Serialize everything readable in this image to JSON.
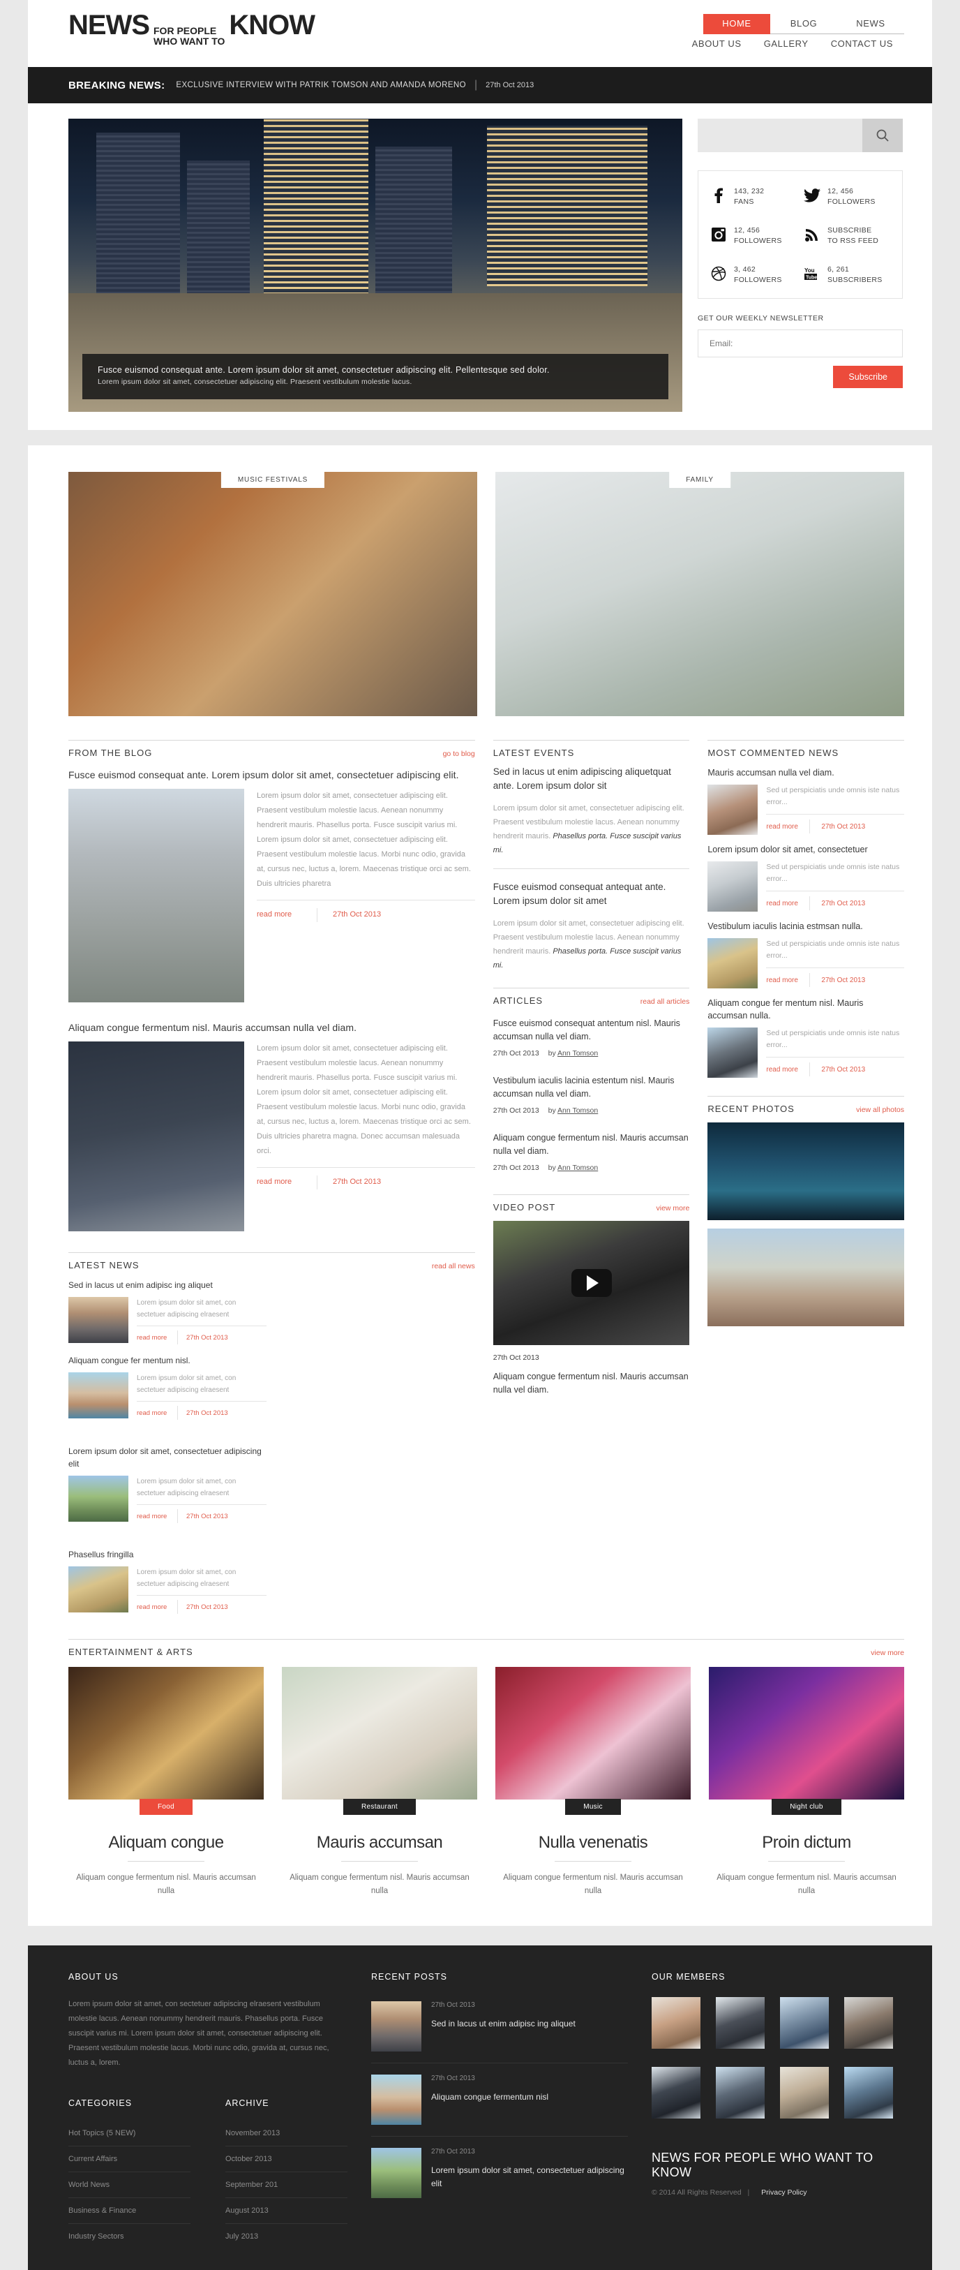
{
  "site": {
    "logo_news": "NEWS",
    "logo_line1": "FOR PEOPLE",
    "logo_line2": "WHO WANT TO",
    "logo_know": "KNOW",
    "accent": "#ec4b3b",
    "dark": "#232323"
  },
  "nav": {
    "row1": [
      {
        "label": "HOME",
        "active": true
      },
      {
        "label": "BLOG",
        "active": false
      },
      {
        "label": "NEWS",
        "active": false
      }
    ],
    "row2": [
      {
        "label": "ABOUT US"
      },
      {
        "label": "GALLERY"
      },
      {
        "label": "CONTACT US"
      }
    ]
  },
  "breaking": {
    "label": "BREAKING NEWS:",
    "text": "EXCLUSIVE INTERVIEW WITH PATRIK TOMSON AND AMANDA MORENO",
    "separator": "|",
    "date": "27th Oct 2013"
  },
  "hero": {
    "caption_line1": "Fusce euismod consequat ante. Lorem ipsum dolor sit amet, consectetuer adipiscing elit. Pellentesque sed dolor.",
    "caption_line2": "Lorem ipsum dolor sit amet, consectetuer adipiscing elit. Praesent vestibulum molestie lacus."
  },
  "search": {
    "value": "",
    "placeholder": "",
    "icon": "search-icon"
  },
  "social": [
    {
      "icon": "facebook-icon",
      "count": "143, 232",
      "label": "FANS"
    },
    {
      "icon": "twitter-icon",
      "count": "12, 456",
      "label": "FOLLOWERS"
    },
    {
      "icon": "instagram-icon",
      "count": "12, 456",
      "label": "FOLLOWERS"
    },
    {
      "icon": "rss-icon",
      "count": "SUBSCRIBE",
      "label": "TO RSS FEED"
    },
    {
      "icon": "dribbble-icon",
      "count": "3, 462",
      "label": "FOLLOWERS"
    },
    {
      "icon": "youtube-icon",
      "count": "6, 261",
      "label": "SUBSCRIBERS"
    }
  ],
  "newsletter": {
    "title": "GET OUR WEEKLY NEWSLETTER",
    "placeholder": "Email:",
    "value": "",
    "button": "Subscribe"
  },
  "features": [
    {
      "badge": "MUSIC FESTIVALS"
    },
    {
      "badge": "FAMILY"
    }
  ],
  "blog": {
    "title": "FROM THE BLOG",
    "link": "go to blog",
    "posts": [
      {
        "title": "Fusce euismod consequat ante. Lorem ipsum dolor sit amet, consectetuer adipiscing elit.",
        "text": "Lorem ipsum dolor sit amet, consectetuer adipiscing elit. Praesent vestibulum molestie lacus. Aenean nonummy hendrerit mauris. Phasellus porta. Fusce suscipit varius mi. Lorem ipsum dolor sit amet, consectetuer adipiscing elit. Praesent vestibulum molestie lacus. Morbi nunc odio, gravida at, cursus nec, luctus a, lorem. Maecenas tristique orci ac sem. Duis ultricies pharetra",
        "read_more": "read more",
        "date": "27th Oct 2013"
      },
      {
        "title": "Aliquam congue fermentum nisl. Mauris accumsan nulla vel diam.",
        "text": "Lorem ipsum dolor sit amet, consectetuer adipiscing elit. Praesent vestibulum molestie lacus. Aenean nonummy hendrerit mauris. Phasellus porta. Fusce suscipit varius mi. Lorem ipsum dolor sit amet, consectetuer adipiscing elit. Praesent vestibulum molestie lacus. Morbi nunc odio, gravida at, cursus nec, luctus a, lorem. Maecenas tristique orci ac sem. Duis ultricies pharetra magna. Donec accumsan malesuada orci.",
        "read_more": "read more",
        "date": "27th Oct 2013"
      }
    ]
  },
  "events": {
    "title": "LATEST EVENTS",
    "items": [
      {
        "title": "Sed in lacus ut enim adipiscing aliquetquat ante. Lorem ipsum dolor sit",
        "text": "Lorem ipsum dolor sit amet, consectetuer adipiscing elit. Praesent vestibulum molestie lacus. Aenean nonummy hendrerit mauris. ",
        "emph": "Phasellus porta. Fusce suscipit varius mi."
      },
      {
        "title": "Fusce euismod consequat antequat ante. Lorem ipsum dolor sit amet",
        "text": "Lorem ipsum dolor sit amet, consectetuer adipiscing elit. Praesent vestibulum molestie lacus. Aenean nonummy hendrerit mauris. ",
        "emph": "Phasellus porta. Fusce suscipit varius mi."
      }
    ]
  },
  "articles": {
    "title": "ARTICLES",
    "link": "read all articles",
    "items": [
      {
        "title": "Fusce euismod consequat antentum nisl. Mauris accumsan nulla vel diam.",
        "date": "27th Oct 2013",
        "by_prefix": "by",
        "author": "Ann Tomson"
      },
      {
        "title": "Vestibulum iaculis lacinia estentum nisl. Mauris accumsan nulla vel diam.",
        "date": "27th Oct 2013",
        "by_prefix": "by",
        "author": "Ann Tomson"
      },
      {
        "title": "Aliquam congue fermentum nisl. Mauris accumsan nulla vel diam.",
        "date": "27th Oct 2013",
        "by_prefix": "by",
        "author": "Ann Tomson"
      }
    ]
  },
  "most_commented": {
    "title": "MOST COMMENTED NEWS",
    "items": [
      {
        "title": "Mauris accumsan nulla vel diam.",
        "text": "Sed ut perspiciatis unde omnis iste natus error...",
        "read_more": "read more",
        "date": "27th Oct 2013"
      },
      {
        "title": "Lorem ipsum dolor sit amet, consectetuer",
        "text": "Sed ut perspiciatis unde omnis iste natus error...",
        "read_more": "read more",
        "date": "27th Oct 2013"
      },
      {
        "title": "Vestibulum iaculis lacinia estmsan nulla.",
        "text": "Sed ut perspiciatis unde omnis iste natus error...",
        "read_more": "read more",
        "date": "27th Oct 2013"
      },
      {
        "title": "Aliquam congue fer mentum nisl. Mauris accumsan nulla.",
        "text": "Sed ut perspiciatis unde omnis iste natus error...",
        "read_more": "read more",
        "date": "27th Oct 2013"
      }
    ]
  },
  "latest_news": {
    "title": "LATEST NEWS",
    "link": "read all news",
    "items": [
      {
        "title": "Sed in lacus ut enim adipisc ing aliquet",
        "text": "Lorem ipsum dolor sit amet, con sectetuer adipiscing elraesent",
        "read_more": "read more",
        "date": "27th Oct 2013"
      },
      {
        "title": "Aliquam congue fer mentum nisl.",
        "text": "Lorem ipsum dolor sit amet, con sectetuer adipiscing elraesent",
        "read_more": "read more",
        "date": "27th Oct 2013"
      },
      {
        "title": "Lorem ipsum dolor sit amet, consectetuer adipiscing elit",
        "text": "Lorem ipsum dolor sit amet, con sectetuer adipiscing elraesent",
        "read_more": "read more",
        "date": "27th Oct 2013"
      },
      {
        "title": "Phasellus fringilla",
        "text": "Lorem ipsum dolor sit amet, con sectetuer adipiscing elraesent",
        "read_more": "read more",
        "date": "27th Oct 2013"
      }
    ]
  },
  "video": {
    "title": "VIDEO POST",
    "link": "view more",
    "date": "27th Oct 2013",
    "caption": "Aliquam congue fermentum nisl. Mauris accumsan nulla vel diam.",
    "play_icon": "play-icon"
  },
  "recent_photos": {
    "title": "RECENT PHOTOS",
    "link": "view all photos"
  },
  "entertainment": {
    "title": "ENTERTAINMENT & ARTS",
    "link": "view more",
    "cards": [
      {
        "tag": "Food",
        "tag_accent": true,
        "name": "Aliquam congue",
        "desc": "Aliquam congue fermentum nisl. Mauris accumsan nulla"
      },
      {
        "tag": "Restaurant",
        "tag_accent": false,
        "name": "Mauris accumsan",
        "desc": "Aliquam congue fermentum nisl. Mauris accumsan nulla"
      },
      {
        "tag": "Music",
        "tag_accent": false,
        "name": "Nulla venenatis",
        "desc": "Aliquam congue fermentum nisl. Mauris accumsan nulla"
      },
      {
        "tag": "Night club",
        "tag_accent": false,
        "name": "Proin dictum",
        "desc": "Aliquam congue fermentum nisl. Mauris accumsan nulla"
      }
    ]
  },
  "footer": {
    "about": {
      "title": "ABOUT US",
      "text": "Lorem ipsum dolor sit amet, con sectetuer adipiscing elraesent vestibulum molestie lacus. Aenean nonummy hendrerit mauris. Phasellus porta. Fusce suscipit varius mi. Lorem ipsum dolor sit amet, consectetuer adipiscing elit. Praesent vestibulum molestie lacus. Morbi nunc odio, gravida at, cursus nec, luctus a, lorem."
    },
    "categories": {
      "title": "CATEGORIES",
      "items": [
        "Hot Topics (5 NEW)",
        "Current Affairs",
        "World News",
        "Business & Finance",
        "Industry Sectors"
      ]
    },
    "archive": {
      "title": "ARCHIVE",
      "items": [
        "November 2013",
        "October 2013",
        "September 201",
        "August 2013",
        "July 2013"
      ]
    },
    "recent_posts": {
      "title": "RECENT POSTS",
      "items": [
        {
          "date": "27th Oct 2013",
          "title": "Sed in lacus ut enim adipisc ing aliquet"
        },
        {
          "date": "27th Oct 2013",
          "title": "Aliquam congue fermentum nisl"
        },
        {
          "date": "27th Oct 2013",
          "title": "Lorem ipsum dolor sit amet, consectetuer adipiscing elit"
        }
      ]
    },
    "members": {
      "title": "OUR MEMBERS",
      "count": 8
    },
    "brand": "NEWS FOR PEOPLE WHO WANT TO KNOW",
    "copyright": "© 2014 All Rights Reserved",
    "copyright_sep": "|",
    "privacy": "Privacy Policy"
  }
}
